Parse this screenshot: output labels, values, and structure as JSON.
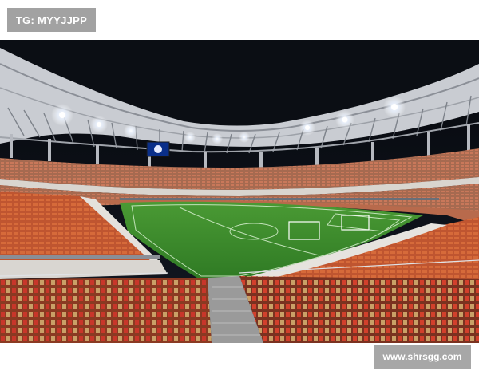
{
  "tag": {
    "label": "TG: MYYJJPP"
  },
  "watermark": {
    "text": "www.shrsgg.com"
  },
  "photo": {
    "subject": "stadium-interior-night",
    "colors": {
      "sky": "#0b0e14",
      "pitch": "#3d8f2e",
      "pitch_dark": "#2f7a24",
      "seat_orange": "#c9562e",
      "seat_red": "#b83424",
      "seat_tan": "#c9a067",
      "roof": "#c9ccd2",
      "lights": "#ffffff"
    }
  }
}
